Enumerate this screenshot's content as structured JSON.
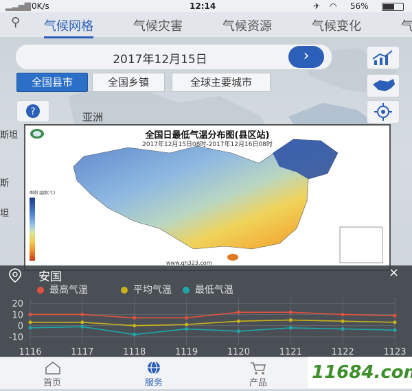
{
  "status_bar": {
    "speed": "0K/s",
    "time": "12:14",
    "battery": "56%"
  },
  "top_tabs": [
    "气候网格",
    "气候灾害",
    "气候资源",
    "气候变化",
    "气"
  ],
  "date": "2017年12月15日",
  "region_buttons": [
    "全国县市",
    "全国乡镇",
    "全球主要城市"
  ],
  "map_labels": {
    "asia": "亚洲",
    "left1": "斯坦",
    "left2": "斯",
    "left3": "坦"
  },
  "popup": {
    "title": "全国日最低气温分布图(县区站)",
    "subtitle": "2017年12月15日08时-2017年12月16日08时",
    "url": "www.qh323.com",
    "legend_title": "图例\n温度(℃)"
  },
  "panel": {
    "station": "安国",
    "close": "×",
    "legend": [
      {
        "label": "最高气温",
        "color": "#e0523f"
      },
      {
        "label": "平均气温",
        "color": "#c9b21a"
      },
      {
        "label": "最低气温",
        "color": "#1fa7a8"
      }
    ]
  },
  "chart_data": {
    "type": "line",
    "x": [
      "1116",
      "1117",
      "1118",
      "1119",
      "1120",
      "1121",
      "1122",
      "1123"
    ],
    "ylim": [
      -15,
      22
    ],
    "yticks": [
      20,
      10,
      0,
      -10
    ],
    "series": [
      {
        "name": "最高气温",
        "color": "#e0523f",
        "values": [
          10,
          10,
          7,
          7,
          12,
          12,
          10,
          9
        ]
      },
      {
        "name": "平均气温",
        "color": "#c9b21a",
        "values": [
          3,
          3,
          0,
          1,
          4,
          5,
          4,
          3
        ]
      },
      {
        "name": "最低气温",
        "color": "#1fa7a8",
        "values": [
          -2,
          -1,
          -8,
          -3,
          -5,
          -2,
          -3,
          -4
        ]
      }
    ]
  },
  "bottom_nav": [
    "首页",
    "服务",
    "产品"
  ],
  "watermark": "11684.com"
}
